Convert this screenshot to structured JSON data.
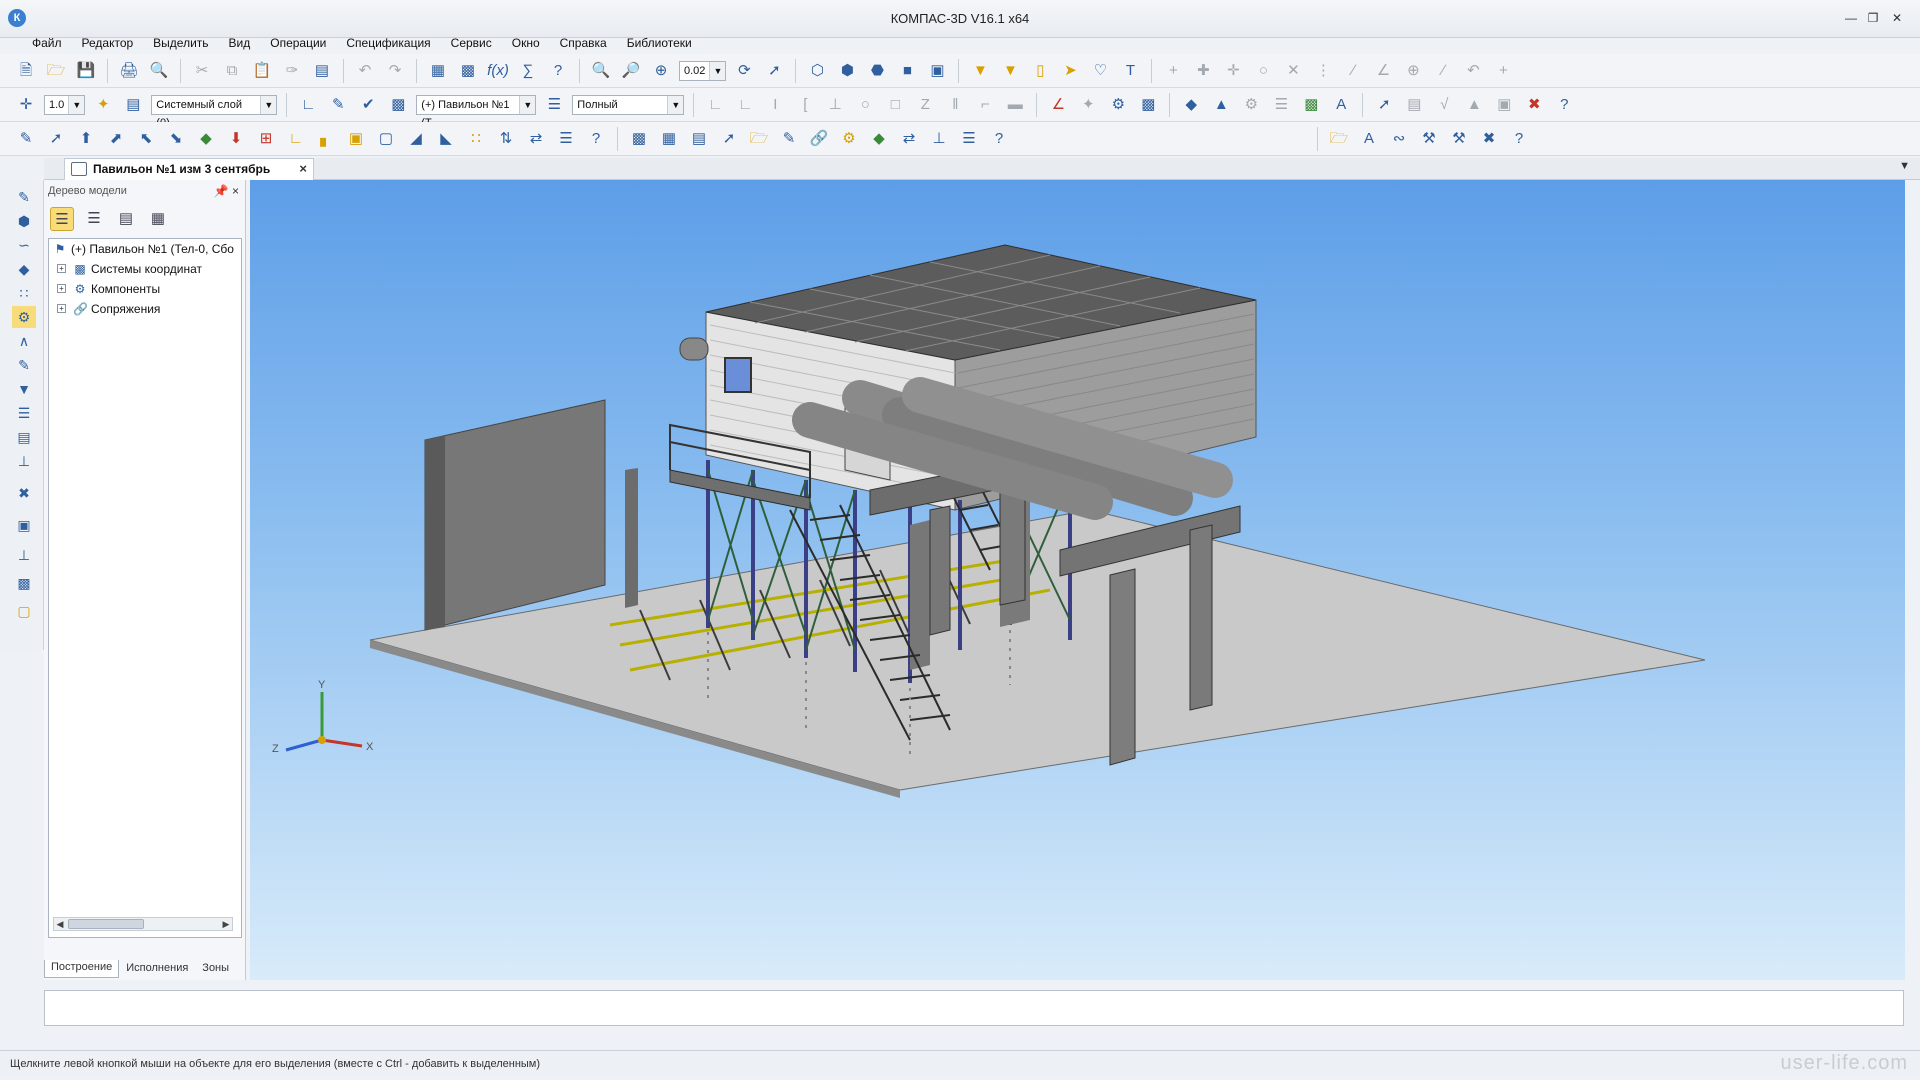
{
  "window": {
    "title": "КОМПАС-3D V16.1 x64",
    "app_icon": "kompas-logo",
    "controls": [
      "minimize-icon",
      "restore-icon",
      "close-icon"
    ]
  },
  "menu": [
    "Файл",
    "Редактор",
    "Выделить",
    "Вид",
    "Операции",
    "Спецификация",
    "Сервис",
    "Окно",
    "Справка",
    "Библиотеки"
  ],
  "toolbar1": {
    "zoom_value": "0.02"
  },
  "toolbar2": {
    "step_value": "1.0",
    "layer_value": "Системный слой (0)",
    "part_value": "(+) Павильон №1 (Т",
    "display_mode_value": "Полный"
  },
  "document": {
    "tab_label": "Павильон №1 изм 3 сентябрь",
    "tab_close": "×"
  },
  "tree_panel": {
    "title": "Дерево модели",
    "pin": "ꟷ",
    "close": "×",
    "items": [
      {
        "label": "(+) Павильон №1 (Тел-0, Сбо",
        "icon": "assembly-icon",
        "level": 0
      },
      {
        "label": "Системы координат",
        "icon": "coordinate-systems-icon",
        "level": 1
      },
      {
        "label": "Компоненты",
        "icon": "components-icon",
        "level": 1
      },
      {
        "label": "Сопряжения",
        "icon": "mates-icon",
        "level": 1
      }
    ],
    "bottom_tabs": [
      "Построение",
      "Исполнения",
      "Зоны"
    ]
  },
  "viewport": {
    "axes": {
      "x": "X",
      "y": "Y",
      "z": "Z"
    },
    "colors": {
      "bg_top": "#5d9ee8",
      "bg_bottom": "#d8ebfa",
      "floor": "#c8c8c8",
      "steel": "#4a4f8c"
    }
  },
  "statusbar": {
    "hint": "Щелкните левой кнопкой мыши на объекте для его выделения (вместе с Ctrl - добавить к выделенным)"
  },
  "watermark": "user-life.com"
}
